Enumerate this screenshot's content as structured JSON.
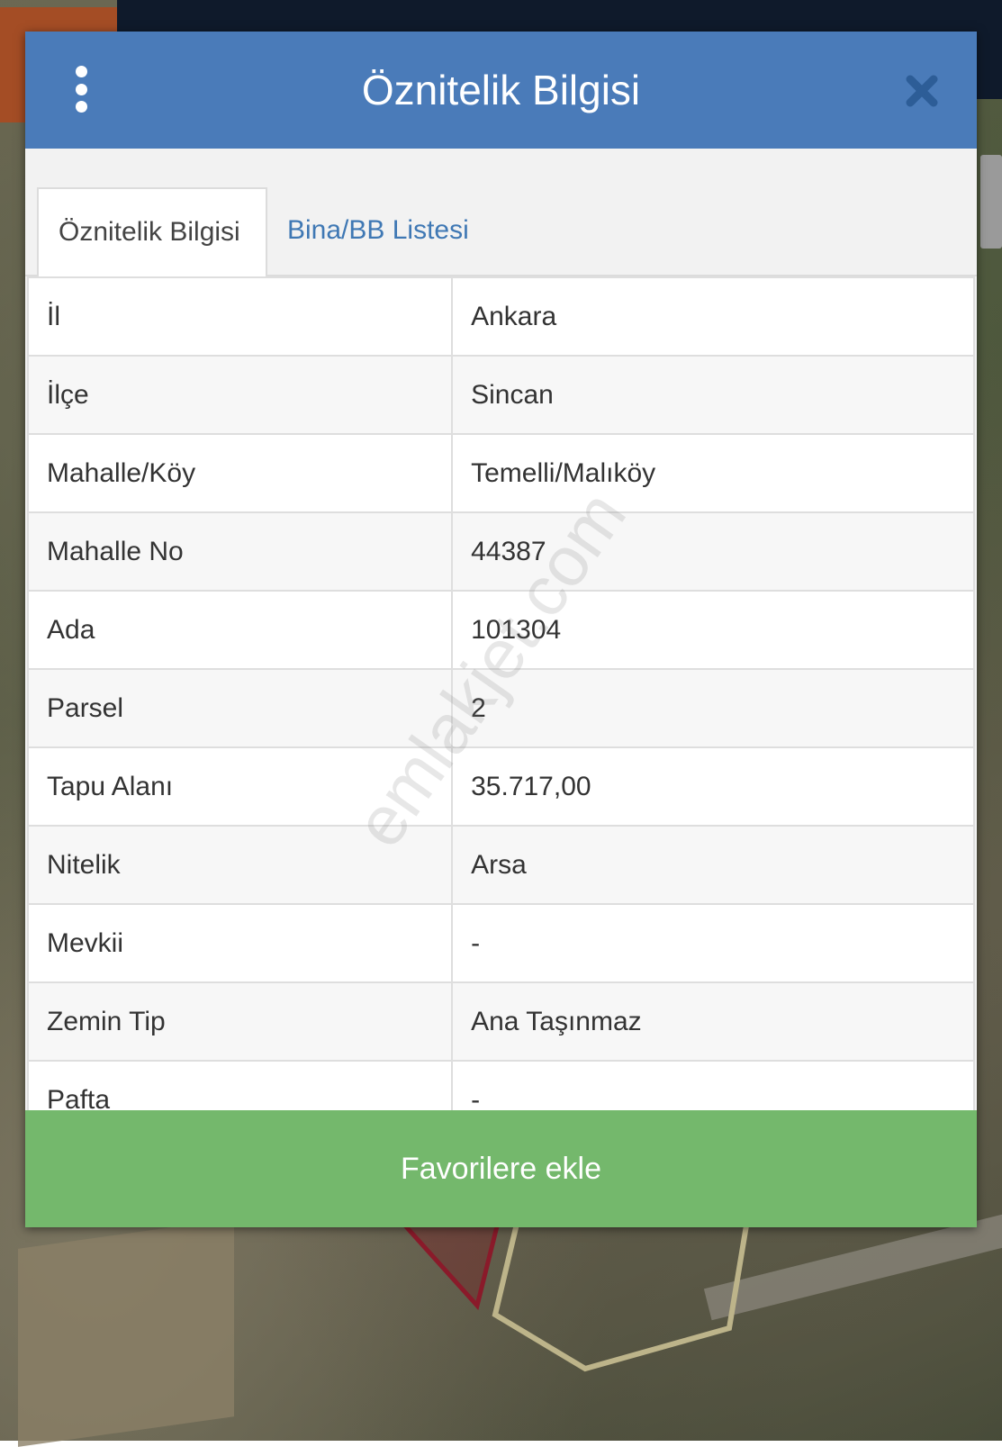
{
  "dialog": {
    "title": "Öznitelik Bilgisi",
    "header_color": "#4a7bb9"
  },
  "tabs": [
    {
      "label": "Öznitelik Bilgisi",
      "active": true
    },
    {
      "label": "Bina/BB Listesi",
      "active": false
    }
  ],
  "attributes": [
    {
      "key": "İl",
      "value": "Ankara"
    },
    {
      "key": "İlçe",
      "value": "Sincan"
    },
    {
      "key": "Mahalle/Köy",
      "value": "Temelli/Malıköy"
    },
    {
      "key": "Mahalle No",
      "value": "44387"
    },
    {
      "key": "Ada",
      "value": "101304"
    },
    {
      "key": "Parsel",
      "value": "2"
    },
    {
      "key": "Tapu Alanı",
      "value": "35.717,00"
    },
    {
      "key": "Nitelik",
      "value": "Arsa"
    },
    {
      "key": "Mevkii",
      "value": "-"
    },
    {
      "key": "Zemin Tip",
      "value": "Ana Taşınmaz"
    },
    {
      "key": "Pafta",
      "value": "-"
    }
  ],
  "favorite_button": {
    "label": "Favorilere ekle",
    "color": "#74b86c"
  },
  "watermark": "emlakjet.com",
  "icons": {
    "menu": "vertical-dots-icon",
    "close": "close-icon"
  }
}
